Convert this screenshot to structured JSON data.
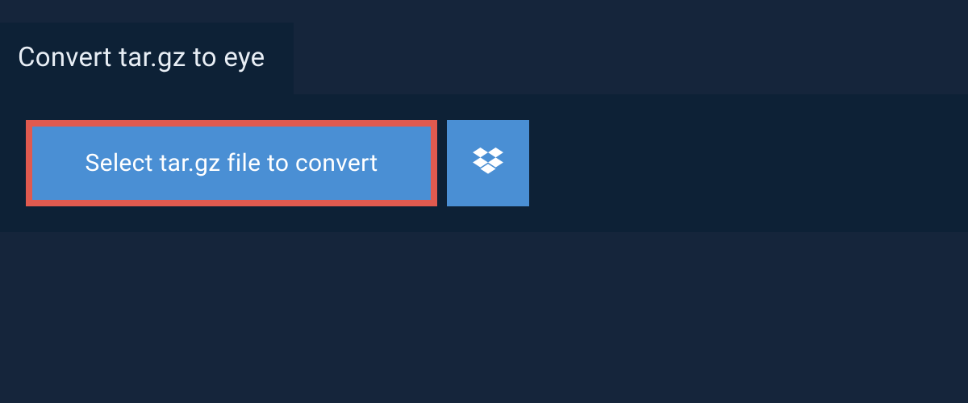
{
  "header": {
    "title": "Convert tar.gz to eye"
  },
  "actions": {
    "select_file_label": "Select tar.gz file to convert"
  },
  "colors": {
    "background_outer": "#15253b",
    "background_panel": "#0d2136",
    "button_blue": "#4a8fd4",
    "button_border": "#e05a4f",
    "text_light": "#e8eef5",
    "text_white": "#ffffff"
  }
}
